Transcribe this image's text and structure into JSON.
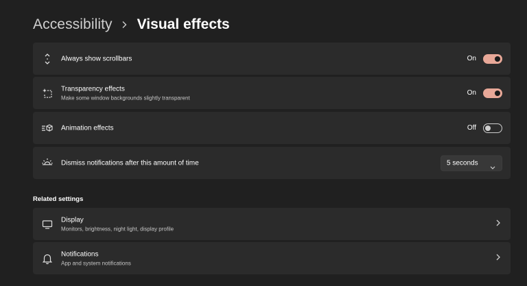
{
  "breadcrumb": {
    "parent": "Accessibility",
    "separator_icon": "chevron-right-icon",
    "current": "Visual effects"
  },
  "settings": [
    {
      "icon": "scrollbar-icon",
      "title": "Always show scrollbars",
      "desc": "",
      "control": "toggle",
      "state_label": "On",
      "on": true
    },
    {
      "icon": "transparency-icon",
      "title": "Transparency effects",
      "desc": "Make some window backgrounds slightly transparent",
      "control": "toggle",
      "state_label": "On",
      "on": true
    },
    {
      "icon": "animation-icon",
      "title": "Animation effects",
      "desc": "",
      "control": "toggle",
      "state_label": "Off",
      "on": false
    },
    {
      "icon": "brightness-icon",
      "title": "Dismiss notifications after this amount of time",
      "desc": "",
      "control": "dropdown",
      "value": "5 seconds"
    }
  ],
  "related": {
    "heading": "Related settings",
    "items": [
      {
        "icon": "monitor-icon",
        "title": "Display",
        "desc": "Monitors, brightness, night light, display profile"
      },
      {
        "icon": "bell-icon",
        "title": "Notifications",
        "desc": "App and system notifications"
      }
    ]
  },
  "colors": {
    "background": "#202020",
    "card": "#2b2b2b",
    "accent_toggle": "#e8a898"
  }
}
